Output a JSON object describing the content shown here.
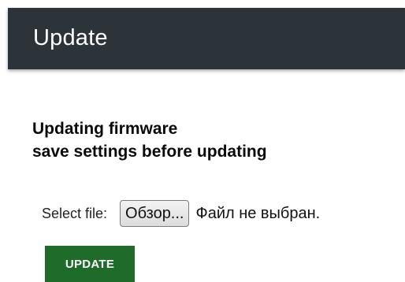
{
  "header": {
    "title": "Update"
  },
  "main": {
    "heading_line1": "Updating firmware",
    "heading_line2": "save settings before updating",
    "file_input": {
      "label": "Select file:",
      "browse_label": "Обзор...",
      "status": "Файл не выбран."
    },
    "update_label": "UPDATE"
  },
  "colors": {
    "header_bg": "#2d3439",
    "update_button_bg": "#1e6b2a"
  }
}
